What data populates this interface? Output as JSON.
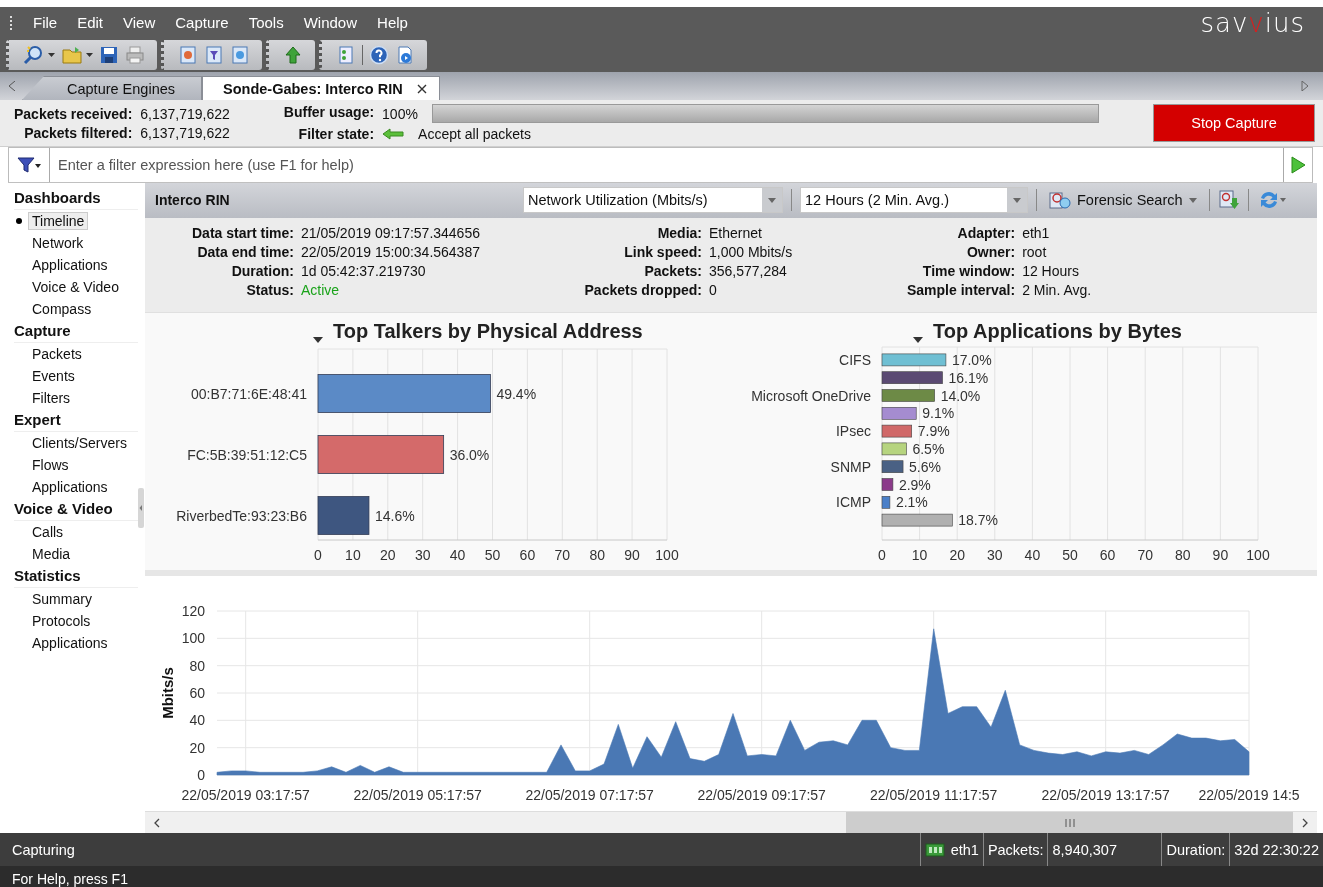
{
  "menu_bar": {
    "items": [
      "File",
      "Edit",
      "View",
      "Capture",
      "Tools",
      "Window",
      "Help"
    ],
    "logo": [
      "sav",
      "v",
      "ius"
    ]
  },
  "tabs": [
    {
      "label": "Capture Engines",
      "selected": false,
      "close": false
    },
    {
      "label": "Sonde-Gabes: Interco RIN",
      "selected": true,
      "close": true
    }
  ],
  "capture_stats": {
    "counters": [
      {
        "label": "Packets received:",
        "value": "6,137,719,622"
      },
      {
        "label": "Packets filtered:",
        "value": "6,137,719,622"
      }
    ],
    "buffer_usage": {
      "label": "Buffer usage:",
      "value": "100%",
      "level": 1.0
    },
    "filter_state": {
      "label": "Filter state:",
      "value": "Accept all packets"
    },
    "stop_button": "Stop Capture"
  },
  "filter_bar": {
    "placeholder": "Enter a filter expression here (use F1 for help)"
  },
  "sidebar": {
    "sections": [
      {
        "title": "Dashboards",
        "items": [
          {
            "label": "Timeline",
            "selected": true
          },
          {
            "label": "Network",
            "selected": false
          },
          {
            "label": "Applications",
            "selected": false
          },
          {
            "label": "Voice & Video",
            "selected": false
          },
          {
            "label": "Compass",
            "selected": false
          }
        ]
      },
      {
        "title": "Capture",
        "items": [
          {
            "label": "Packets",
            "selected": false
          },
          {
            "label": "Events",
            "selected": false
          },
          {
            "label": "Filters",
            "selected": false
          }
        ]
      },
      {
        "title": "Expert",
        "items": [
          {
            "label": "Clients/Servers",
            "selected": false
          },
          {
            "label": "Flows",
            "selected": false
          },
          {
            "label": "Applications",
            "selected": false
          }
        ]
      },
      {
        "title": "Voice & Video",
        "items": [
          {
            "label": "Calls",
            "selected": false
          },
          {
            "label": "Media",
            "selected": false
          }
        ]
      },
      {
        "title": "Statistics",
        "items": [
          {
            "label": "Summary",
            "selected": false
          },
          {
            "label": "Protocols",
            "selected": false
          },
          {
            "label": "Applications",
            "selected": false
          }
        ]
      }
    ]
  },
  "dashboard": {
    "title": "Interco RIN",
    "view_select": "Network Utilization (Mbits/s)",
    "range_select": "12 Hours (2 Min. Avg.)",
    "forensic_button": "Forensic Search",
    "info_columns": [
      [
        {
          "label": "Data start time:",
          "value": "21/05/2019 09:17:57.344656",
          "kind": "plain"
        },
        {
          "label": "Data end time:",
          "value": "22/05/2019 15:00:34.564387",
          "kind": "plain"
        },
        {
          "label": "Duration:",
          "value": "1d 05:42:37.219730",
          "kind": "plain"
        },
        {
          "label": "Status:",
          "value": "Active",
          "kind": "status"
        }
      ],
      [
        {
          "label": "Media:",
          "value": "Ethernet",
          "kind": "plain"
        },
        {
          "label": "Link speed:",
          "value": "1,000 Mbits/s",
          "kind": "plain"
        },
        {
          "label": "Packets:",
          "value": "356,577,284",
          "kind": "plain"
        },
        {
          "label": "Packets dropped:",
          "value": "0",
          "kind": "plain"
        }
      ],
      [
        {
          "label": "Adapter:",
          "value": "eth1",
          "kind": "plain"
        },
        {
          "label": "Owner:",
          "value": "root",
          "kind": "plain"
        },
        {
          "label": "Time window:",
          "value": "12 Hours",
          "kind": "plain"
        },
        {
          "label": "Sample interval:",
          "value": "2 Min. Avg.",
          "kind": "plain"
        }
      ]
    ],
    "top_talkers": {
      "chart_data": {
        "type": "bar",
        "orientation": "horizontal",
        "title": "Top Talkers by Physical Address",
        "categories": [
          "00:B7:71:6E:48:41",
          "FC:5B:39:51:12:C5",
          "RiverbedTe:93:23:B6"
        ],
        "values": [
          49.4,
          36.0,
          14.6
        ],
        "colors": [
          "#5b8ac6",
          "#d46a6a",
          "#3e5680"
        ],
        "value_labels": [
          "49.4%",
          "36.0%",
          "14.6%"
        ],
        "xlim": [
          0,
          100
        ],
        "xticks": [
          0,
          10,
          20,
          30,
          40,
          50,
          60,
          70,
          80,
          90,
          100
        ],
        "grid": true
      }
    },
    "top_applications": {
      "chart_data": {
        "type": "bar",
        "orientation": "horizontal",
        "title": "Top Applications by Bytes",
        "categories": [
          "CIFS",
          null,
          "Microsoft OneDrive",
          null,
          "IPsec",
          null,
          "SNMP",
          null,
          "ICMP",
          null
        ],
        "values": [
          17.0,
          16.1,
          14.0,
          9.1,
          7.9,
          6.5,
          5.6,
          2.9,
          2.1,
          18.7
        ],
        "colors": [
          "#6fbfd3",
          "#5b4a73",
          "#6d8a46",
          "#a58cd0",
          "#d06868",
          "#b6d47f",
          "#4a6184",
          "#8b3a8a",
          "#4a7fc8",
          "#b0b0b0"
        ],
        "value_labels": [
          "17.0%",
          "16.1%",
          "14.0%",
          "9.1%",
          "7.9%",
          "6.5%",
          "5.6%",
          "2.9%",
          "2.1%",
          "18.7%"
        ],
        "xlim": [
          0,
          100
        ],
        "xticks": [
          0,
          10,
          20,
          30,
          40,
          50,
          60,
          70,
          80,
          90,
          100
        ],
        "grid": true
      }
    },
    "timeline": {
      "chart_data": {
        "type": "area",
        "ylabel": "Mbits/s",
        "ylim": [
          0,
          120
        ],
        "yticks": [
          0,
          20,
          40,
          60,
          80,
          100,
          120
        ],
        "grid": true,
        "categories": [
          null,
          null,
          "22/05/2019 03:17:57",
          null,
          null,
          null,
          null,
          null,
          null,
          null,
          null,
          null,
          null,
          null,
          "22/05/2019 05:17:57",
          null,
          null,
          null,
          null,
          null,
          null,
          null,
          null,
          null,
          null,
          null,
          "22/05/2019 07:17:57",
          null,
          null,
          null,
          null,
          null,
          null,
          null,
          null,
          null,
          null,
          null,
          "22/05/2019 09:17:57",
          null,
          null,
          null,
          null,
          null,
          null,
          null,
          null,
          null,
          null,
          null,
          "22/05/2019 11:17:57",
          null,
          null,
          null,
          null,
          null,
          null,
          null,
          null,
          null,
          null,
          null,
          "22/05/2019 13:17:57",
          null,
          null,
          null,
          null,
          null,
          null,
          null,
          null,
          null,
          "22/05/2019 14:5"
        ],
        "series": [
          {
            "color": "#4a78b4",
            "values": [
              2,
              3,
              3,
              2,
              2,
              2,
              2,
              3,
              6,
              2,
              7,
              2,
              6,
              2,
              2,
              2,
              2,
              2,
              2,
              2,
              2,
              2,
              2,
              2,
              22,
              3,
              3,
              8,
              37,
              5,
              28,
              13,
              39,
              12,
              10,
              15,
              45,
              14,
              15,
              14,
              40,
              18,
              24,
              25,
              22,
              40,
              40,
              20,
              18,
              18,
              107,
              45,
              50,
              50,
              35,
              62,
              22,
              18,
              16,
              15,
              17,
              14,
              17,
              16,
              18,
              15,
              22,
              30,
              27,
              27,
              25,
              26,
              17
            ]
          }
        ]
      }
    }
  },
  "status_bar": {
    "state": "Capturing",
    "adapter": "eth1",
    "packets_label": "Packets:",
    "packets": "8,940,307",
    "duration_label": "Duration:",
    "duration": "32d 22:30:22",
    "help": "For Help, press F1"
  }
}
